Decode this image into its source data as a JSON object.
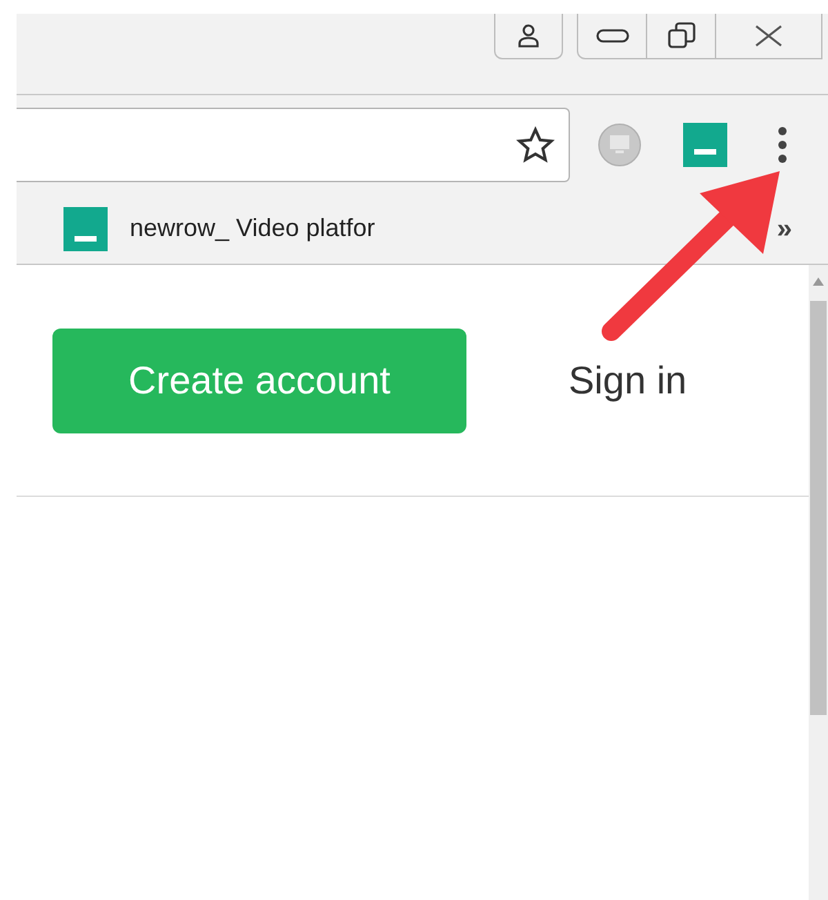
{
  "bookmarks_bar": {
    "bookmark": {
      "label": "newrow_ Video platfor"
    },
    "overflow": "»"
  },
  "page": {
    "create_account": "Create account",
    "sign_in": "Sign in"
  }
}
